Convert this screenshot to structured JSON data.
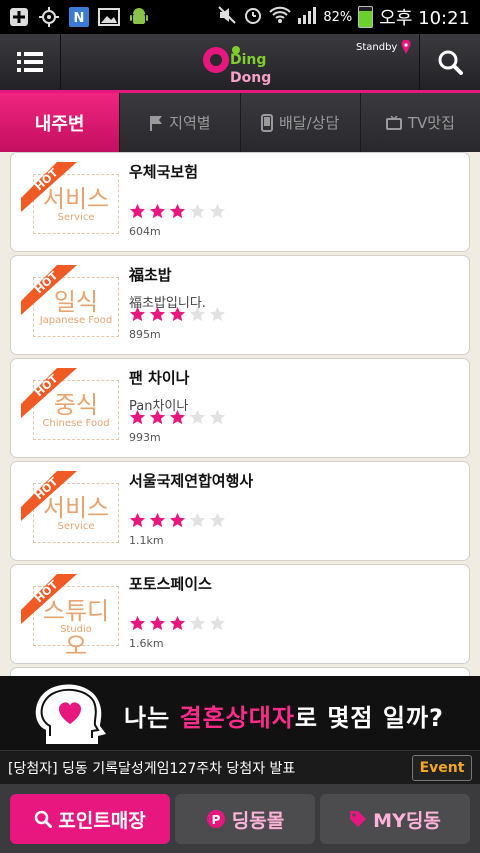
{
  "statusbar": {
    "battery": "82%",
    "time": "오후 10:21",
    "battery_level": 0.82,
    "icons": [
      "plus-icon",
      "gps-icon",
      "n-icon",
      "image-icon",
      "android-icon",
      "mute-icon",
      "alarm-icon",
      "wifi-icon",
      "signal-icon"
    ]
  },
  "header": {
    "logo_line1": "Ding",
    "logo_line2": "Dong",
    "standby": "Standby"
  },
  "tabs": [
    {
      "label": "내주변",
      "icon": "none"
    },
    {
      "label": "지역별",
      "icon": "flag-icon"
    },
    {
      "label": "배달/상담",
      "icon": "phone-icon"
    },
    {
      "label": "TV맛집",
      "icon": "tv-icon"
    }
  ],
  "items": [
    {
      "category": "서비스",
      "category_en": "Service",
      "badge": "HOT",
      "name": "우체국보험",
      "desc": "",
      "rating": 3,
      "rating_max": 5,
      "distance": "604m"
    },
    {
      "category": "일식",
      "category_en": "Japanese Food",
      "badge": "HOT",
      "name": "福초밥",
      "desc": "福초밥입니다.",
      "rating": 3,
      "rating_max": 5,
      "distance": "895m"
    },
    {
      "category": "중식",
      "category_en": "Chinese Food",
      "badge": "HOT",
      "name": "팬 차이나",
      "desc": "Pan차이나",
      "rating": 3,
      "rating_max": 5,
      "distance": "993m"
    },
    {
      "category": "서비스",
      "category_en": "Service",
      "badge": "HOT",
      "name": "서울국제연합여행사",
      "desc": "",
      "rating": 3,
      "rating_max": 5,
      "distance": "1.1km"
    },
    {
      "category": "스튜디오",
      "category_en": "Studio",
      "badge": "HOT",
      "name": "포토스페이스",
      "desc": "",
      "rating": 3,
      "rating_max": 5,
      "distance": "1.6km"
    }
  ],
  "banner": {
    "text_before": "나는 ",
    "text_highlight": "결혼상대자",
    "text_after": "로 몇점 일까?"
  },
  "ticker": {
    "text": "[당첨자] 딩동 기록달성게임127주차 당첨자 발표",
    "event_label": "Event"
  },
  "bottom_nav": [
    {
      "label": "포인트매장",
      "icon": "search-icon"
    },
    {
      "label": "딩동몰",
      "icon": "p-coin-icon"
    },
    {
      "label": "MY딩동",
      "icon": "tag-icon"
    }
  ],
  "colors": {
    "accent": "#e8177f",
    "category": "#e6a46f",
    "ribbon": "#f05a24"
  }
}
